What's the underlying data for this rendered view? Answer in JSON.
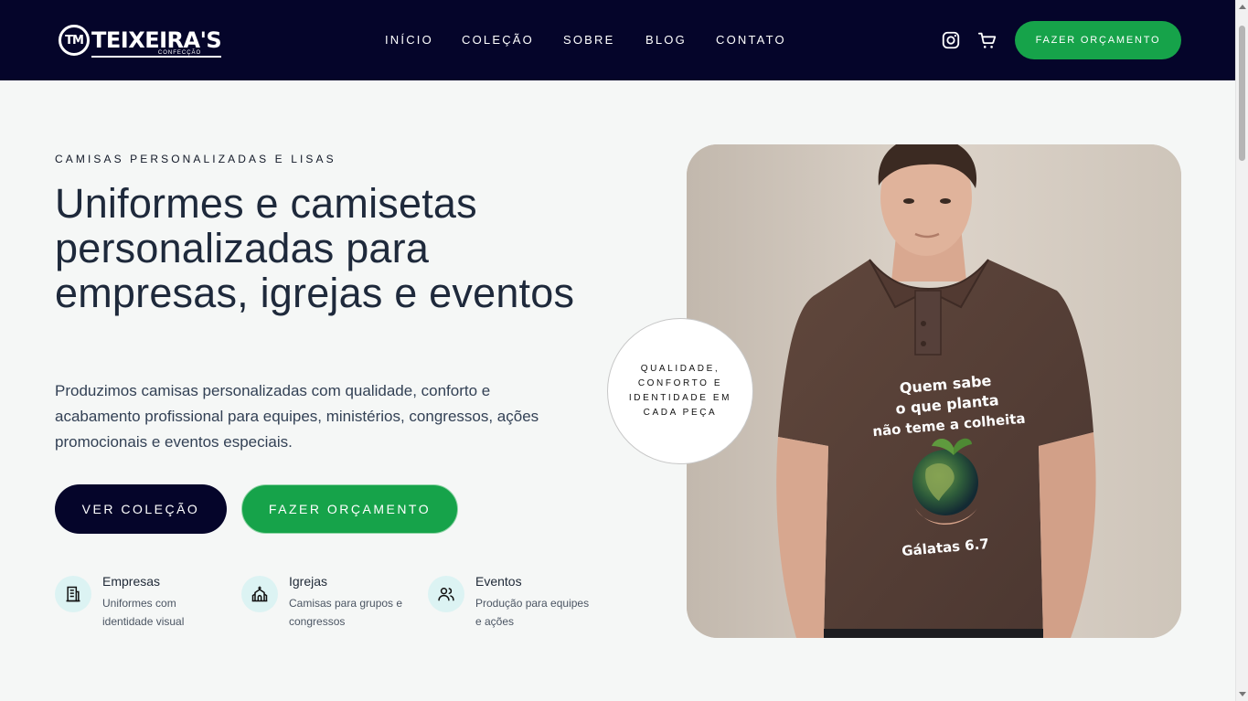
{
  "brand": {
    "mark": "TM",
    "name": "TEIXEIRA'S",
    "sub": "CONFECÇÃO"
  },
  "nav": {
    "items": [
      {
        "label": "INÍCIO"
      },
      {
        "label": "COLEÇÃO"
      },
      {
        "label": "SOBRE"
      },
      {
        "label": "BLOG"
      },
      {
        "label": "CONTATO"
      }
    ],
    "cta_label": "FAZER ORÇAMENTO",
    "icons": [
      "instagram-icon",
      "cart-icon"
    ]
  },
  "hero": {
    "eyebrow": "CAMISAS PERSONALIZADAS E LISAS",
    "title": "Uniformes e camisetas personalizadas para empresas, igrejas e eventos",
    "description": "Produzimos camisas personalizadas com qualidade, conforto e acabamento profissional para equipes, ministérios, congressos, ações promocionais e eventos especiais.",
    "primary_button": "VER COLEÇÃO",
    "secondary_button": "FAZER ORÇAMENTO",
    "badge": "QUALIDADE, CONFORTO E IDENTIDADE EM CADA PEÇA"
  },
  "features": [
    {
      "icon": "building-icon",
      "title": "Empresas",
      "desc": "Uniformes com identidade visual"
    },
    {
      "icon": "church-icon",
      "title": "Igrejas",
      "desc": "Camisas para grupos e congressos"
    },
    {
      "icon": "users-icon",
      "title": "Eventos",
      "desc": "Produção para equipes e ações"
    }
  ],
  "shirt_print": {
    "line1": "Quem sabe",
    "line2": "o que planta",
    "line3": "não teme a colheita",
    "verse": "Gálatas 6.7"
  },
  "colors": {
    "navy": "#05052a",
    "green": "#16a34a",
    "page_bg": "#f5f7f6",
    "shirt": "#5a4238"
  }
}
